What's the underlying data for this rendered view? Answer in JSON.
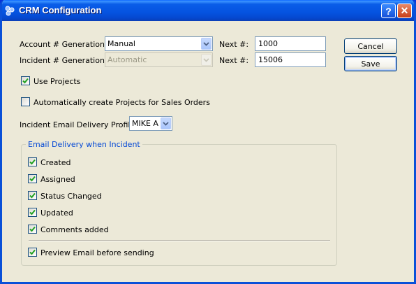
{
  "window": {
    "title": "CRM Configuration",
    "help_label": "?",
    "close_label": "✕"
  },
  "account": {
    "label": "Account # Generation:",
    "value": "Manual",
    "next_label": "Next #:",
    "next_value": "1000"
  },
  "incident": {
    "label": "Incident # Generation:",
    "value": "Automatic",
    "next_label": "Next #:",
    "next_value": "15006"
  },
  "buttons": {
    "cancel": "Cancel",
    "save": "Save"
  },
  "use_projects": {
    "label": "Use Projects",
    "checked": true
  },
  "auto_projects": {
    "label": "Automatically create Projects for Sales Orders",
    "checked": false
  },
  "email_profile": {
    "label": "Incident Email Delivery Profile:",
    "value": "MIKE A"
  },
  "email_group": {
    "title": "Email Delivery when Incident",
    "items": [
      {
        "label": "Created",
        "checked": true
      },
      {
        "label": "Assigned",
        "checked": true
      },
      {
        "label": "Status Changed",
        "checked": true
      },
      {
        "label": "Updated",
        "checked": true
      },
      {
        "label": "Comments added",
        "checked": true
      }
    ],
    "preview": {
      "label": "Preview Email before sending",
      "checked": true
    }
  },
  "colors": {
    "titlebar": "#0553e0",
    "window_bg": "#ece9d8",
    "checkmark": "#21a121",
    "group_title": "#0046d5"
  }
}
